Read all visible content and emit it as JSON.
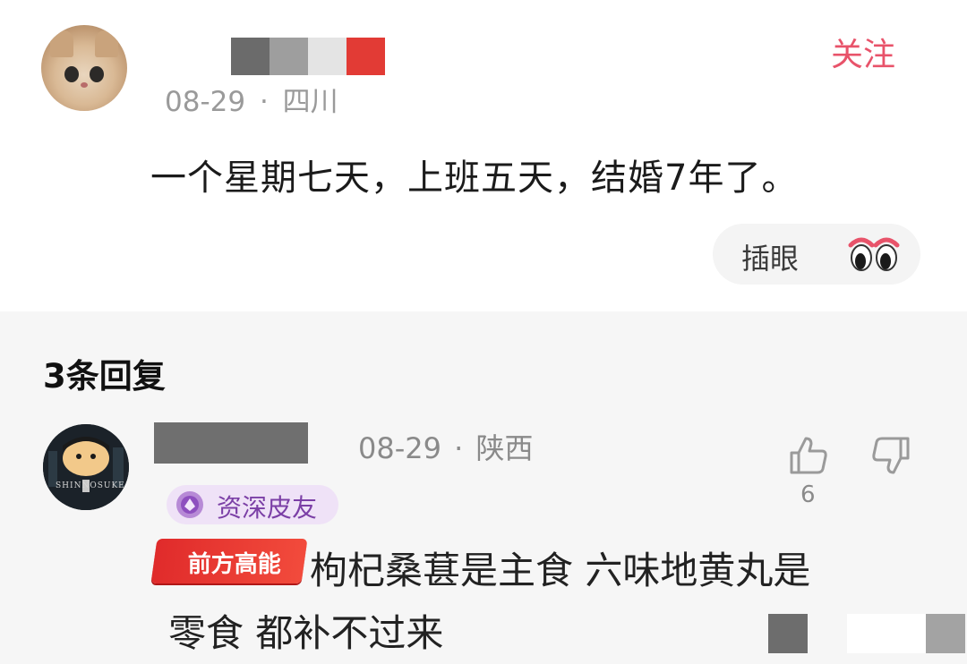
{
  "post": {
    "meta_date": "08-29",
    "meta_sep": "·",
    "meta_location": "四川",
    "follow_label": "关注",
    "text": "一个星期七天，上班五天，结婚7年了。",
    "reaction_label": "插眼",
    "avatar_icon": "cat-avatar-icon",
    "name_mask_colors": [
      "#6b6b6b",
      "#9e9e9e",
      "#e4e4e4",
      "#e23b35"
    ]
  },
  "replies": {
    "title": "3条回复",
    "items": [
      {
        "meta_date": "08-29",
        "meta_sep": "·",
        "meta_location": "陕西",
        "badge_label": "资深皮友",
        "tag_label": "前方高能",
        "avatar_text": "SHINNOSUKE",
        "text_line1": "枸杞桑葚是主食  六味地黄丸是",
        "text_line2": "零食 都补不过来",
        "like_count": "6"
      }
    ],
    "mosaic_colors": [
      "#6d6d6d",
      "#f6f6f6",
      "#ffffff",
      "#a3a3a3"
    ]
  },
  "colors": {
    "accent": "#e8536a",
    "badge_text": "#7b3fa6",
    "tag_red": "#e02b2b"
  }
}
